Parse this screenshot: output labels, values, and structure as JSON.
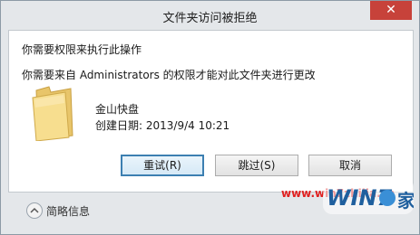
{
  "window": {
    "title": "文件夹访问被拒绝",
    "close_label": "✕"
  },
  "message": {
    "heading": "你需要权限来执行此操作",
    "detail": "你需要来自 Administrators 的权限才能对此文件夹进行更改"
  },
  "item": {
    "name": "金山快盘",
    "created": "创建日期: 2013/9/4 10:21"
  },
  "buttons": {
    "retry": "重试(R)",
    "skip": "跳过(S)",
    "cancel": "取消"
  },
  "footer": {
    "details_label": "简略信息"
  },
  "watermark": {
    "url": "www.win7zhijia.cn",
    "logo_text": "Win7之家"
  }
}
